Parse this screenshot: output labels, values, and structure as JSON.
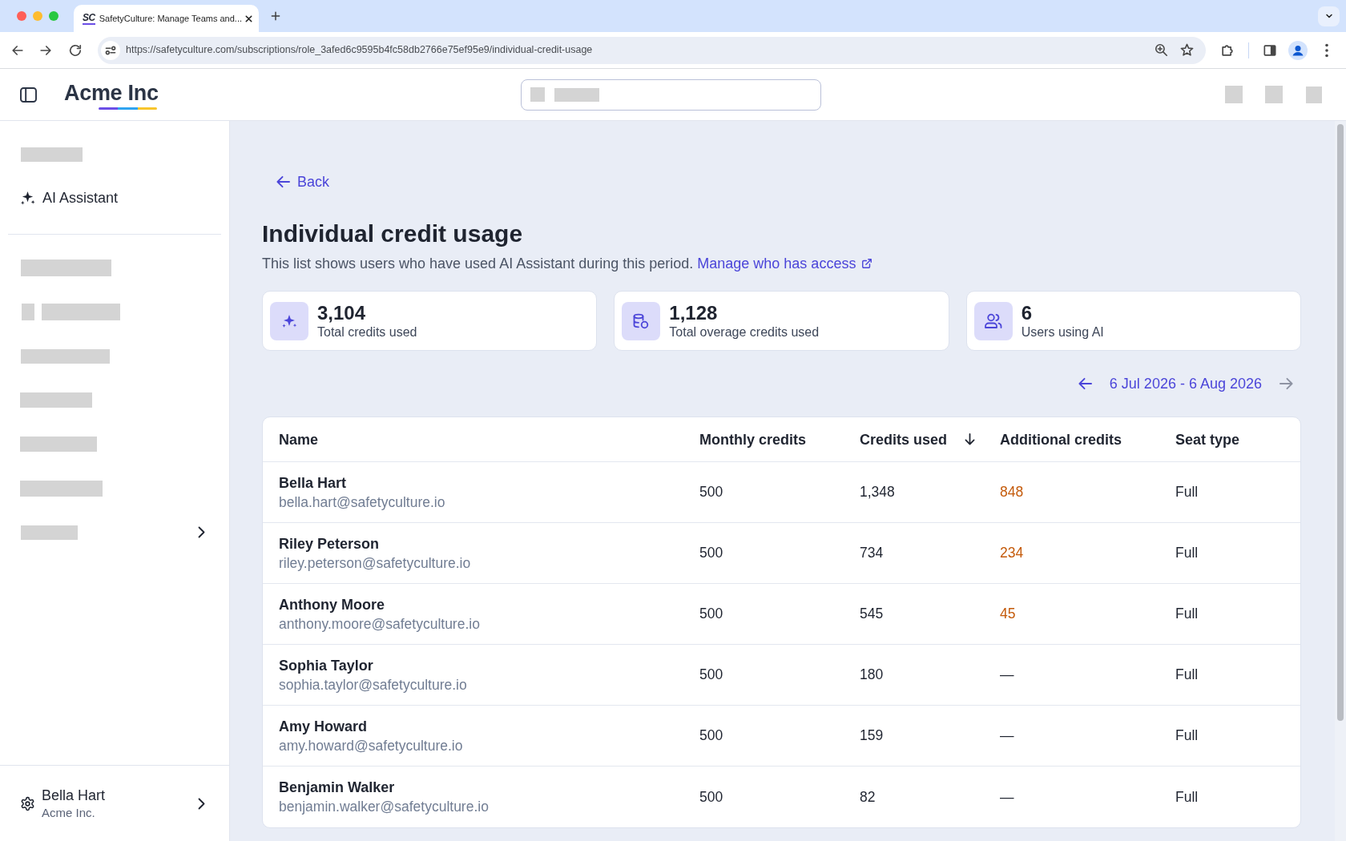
{
  "browser": {
    "tabs": [
      {
        "icon_text": "SC",
        "title": "SafetyCulture: Manage Teams and...",
        "selected": true
      }
    ],
    "url": "https://safetyculture.com/subscriptions/role_3afed6c9595b4fc58db2766e75ef95e9/individual-credit-usage"
  },
  "app_header": {
    "logo": "Acme Inc"
  },
  "sidebar": {
    "items": [
      {
        "label": "AI Assistant"
      }
    ],
    "user": {
      "name": "Bella Hart",
      "organization": "Acme Inc."
    }
  },
  "page": {
    "back": "Back",
    "title": "Individual credit usage",
    "description": "This list shows users who have used AI Assistant during this period.",
    "access_link": "Manage who has access"
  },
  "stats": [
    {
      "kind": "credits",
      "value": "3,104",
      "label": "Total credits used"
    },
    {
      "kind": "overage",
      "value": "1,128",
      "label": "Total overage credits used"
    },
    {
      "kind": "users",
      "value": "6",
      "label": "Users using AI"
    }
  ],
  "period": {
    "label": "6 Jul 2026 - 6 Aug 2026",
    "previous_disabled": false,
    "next_disabled": true
  },
  "table": {
    "columns": [
      {
        "label": "Name",
        "sorted": false
      },
      {
        "label": "Monthly credits",
        "sorted": false
      },
      {
        "label": "Credits used",
        "sorted": true
      },
      {
        "label": "Additional credits",
        "sorted": false
      },
      {
        "label": "Seat type",
        "sorted": false
      }
    ],
    "rows": [
      {
        "name": "Bella Hart",
        "email": "bella.hart@safetyculture.io",
        "monthly_credits": "500",
        "credits_used": "1,348",
        "additional_credits": "848",
        "over_limit": true,
        "seat_type": "Full"
      },
      {
        "name": "Riley Peterson",
        "email": "riley.peterson@safetyculture.io",
        "monthly_credits": "500",
        "credits_used": "734",
        "additional_credits": "234",
        "over_limit": true,
        "seat_type": "Full"
      },
      {
        "name": "Anthony Moore",
        "email": "anthony.moore@safetyculture.io",
        "monthly_credits": "500",
        "credits_used": "545",
        "additional_credits": "45",
        "over_limit": true,
        "seat_type": "Full"
      },
      {
        "name": "Sophia Taylor",
        "email": "sophia.taylor@safetyculture.io",
        "monthly_credits": "500",
        "credits_used": "180",
        "additional_credits": "—",
        "over_limit": false,
        "seat_type": "Full"
      },
      {
        "name": "Amy Howard",
        "email": "amy.howard@safetyculture.io",
        "monthly_credits": "500",
        "credits_used": "159",
        "additional_credits": "—",
        "over_limit": false,
        "seat_type": "Full"
      },
      {
        "name": "Benjamin Walker",
        "email": "benjamin.walker@safetyculture.io",
        "monthly_credits": "500",
        "credits_used": "82",
        "additional_credits": "—",
        "over_limit": false,
        "seat_type": "Full"
      }
    ]
  }
}
